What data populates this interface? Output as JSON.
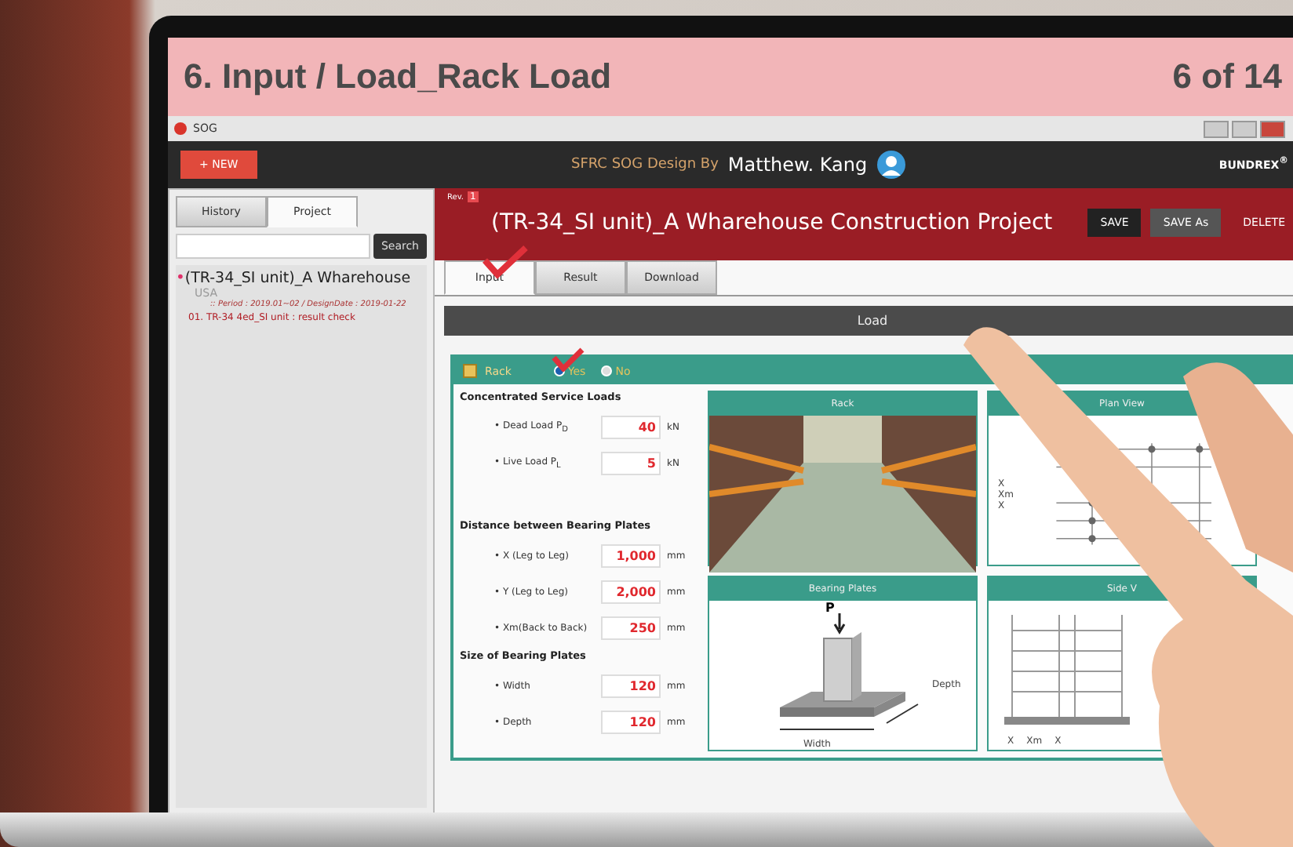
{
  "slide": {
    "title": "6. Input / Load_Rack Load",
    "page": "6 of 14"
  },
  "window": {
    "title": "SOG"
  },
  "header": {
    "new_button": "+ NEW",
    "tagline": "SFRC SOG Design By",
    "author": "Matthew. Kang",
    "brand": "BUNDREX$^{®}$"
  },
  "sidebar": {
    "tabs": [
      {
        "label": "History",
        "selected": false
      },
      {
        "label": "Project",
        "selected": true
      }
    ],
    "search_button": "Search",
    "project": {
      "bullet": "•",
      "title": "(TR-34_SI unit)_A Wharehouse",
      "country": "USA",
      "dates": ":: Period : 2019.01~02 / DesignDate : 2019-01-22",
      "items": [
        {
          "label": "01. TR-34 4ed_SI unit : result check",
          "selected": true
        }
      ]
    }
  },
  "project": {
    "rev_label": "Rev.",
    "rev": "1",
    "title": "(TR-34_SI unit)_A Wharehouse Construction Project",
    "buttons": [
      {
        "label": "SAVE",
        "kind": "dark"
      },
      {
        "label": "SAVE As",
        "kind": "grey"
      },
      {
        "label": "DELETE",
        "kind": "plain"
      }
    ]
  },
  "tabs": [
    {
      "label": "Input",
      "selected": true
    },
    {
      "label": "Result",
      "selected": false
    },
    {
      "label": "Download",
      "selected": false
    }
  ],
  "section_title": "Load",
  "rack": {
    "label": "Rack",
    "options": [
      {
        "label": "Yes",
        "selected": true
      },
      {
        "label": "No",
        "selected": false
      }
    ]
  },
  "groups": [
    {
      "title": "Concentrated Service Loads",
      "fields": [
        {
          "label": "• Dead Load P$_{D}$",
          "value": "40",
          "unit": "kN"
        },
        {
          "label": "• Live  Load  P$_{L}$",
          "value": "5",
          "unit": "kN"
        }
      ]
    },
    {
      "title": "Distance between Bearing Plates",
      "fields": [
        {
          "label": "• X (Leg to Leg)",
          "value": "1,000",
          "unit": "mm"
        },
        {
          "label": "• Y (Leg to Leg)",
          "value": "2,000",
          "unit": "mm"
        },
        {
          "label": "• Xm(Back to Back)",
          "value": "250",
          "unit": "mm"
        }
      ]
    },
    {
      "title": "Size of Bearing Plates",
      "fields": [
        {
          "label": "• Width",
          "value": "120",
          "unit": "mm"
        },
        {
          "label": "• Depth",
          "value": "120",
          "unit": "mm"
        }
      ]
    }
  ],
  "figures": [
    {
      "title": "Rack",
      "kind": "photo"
    },
    {
      "title": "Plan View",
      "kind": "plan",
      "labels": [
        "X",
        "Xm",
        "X"
      ]
    },
    {
      "title": "Bearing Plates",
      "kind": "plate",
      "labels": [
        "P",
        "Depth",
        "Width"
      ]
    },
    {
      "title": "Side V",
      "kind": "side",
      "labels": [
        "X",
        "Xm",
        "X"
      ]
    }
  ]
}
